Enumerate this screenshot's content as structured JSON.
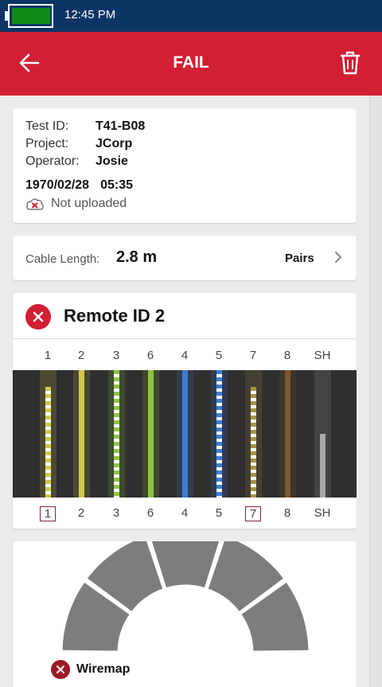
{
  "status_bar": {
    "time": "12:45 PM",
    "battery_icon": "battery-icon",
    "battery_color": "#0f8a14"
  },
  "app_bar": {
    "title": "FAIL",
    "back_icon": "arrow-left-icon",
    "delete_icon": "trash-icon",
    "color": "#d11f33"
  },
  "test_info": {
    "rows": [
      {
        "label": "Test ID:",
        "value": "T41-B08"
      },
      {
        "label": "Project:",
        "value": "JCorp"
      },
      {
        "label": "Operator:",
        "value": "Josie"
      }
    ],
    "date": "1970/02/28",
    "time": "05:35",
    "upload_status": "Not uploaded",
    "upload_icon": "cloud-error-icon"
  },
  "cable_length": {
    "label": "Cable Length:",
    "value": "2.8 m",
    "pairs_label": "Pairs"
  },
  "remote": {
    "title": "Remote ID 2",
    "status_icon": "fail-icon",
    "top_pins": [
      "1",
      "2",
      "3",
      "6",
      "4",
      "5",
      "7",
      "8",
      "SH"
    ],
    "bottom_pins": [
      "1",
      "2",
      "3",
      "6",
      "4",
      "5",
      "7",
      "8",
      "SH"
    ],
    "boxed_bottom_pins": [
      "1",
      "7"
    ],
    "wires": [
      {
        "pin": "1",
        "color": "#d4c84a",
        "stripe": true,
        "length": 0.87
      },
      {
        "pin": "2",
        "color": "#d4c84a",
        "stripe": false,
        "length": 1.0
      },
      {
        "pin": "3",
        "color": "#8dc63f",
        "stripe": true,
        "length": 1.0
      },
      {
        "pin": "6",
        "color": "#8dc63f",
        "stripe": false,
        "length": 1.0
      },
      {
        "pin": "4",
        "color": "#3b7fd9",
        "stripe": false,
        "length": 1.0
      },
      {
        "pin": "5",
        "color": "#3b7fd9",
        "stripe": true,
        "length": 1.0
      },
      {
        "pin": "7",
        "color": "#a8913f",
        "stripe": true,
        "length": 0.87
      },
      {
        "pin": "8",
        "color": "#7a5a2a",
        "stripe": false,
        "length": 1.0
      },
      {
        "pin": "SH",
        "color": "#a8a8a8",
        "stripe": false,
        "length": 0.5
      }
    ]
  },
  "wiremap": {
    "label": "Wiremap",
    "status_icon": "fail-icon"
  }
}
